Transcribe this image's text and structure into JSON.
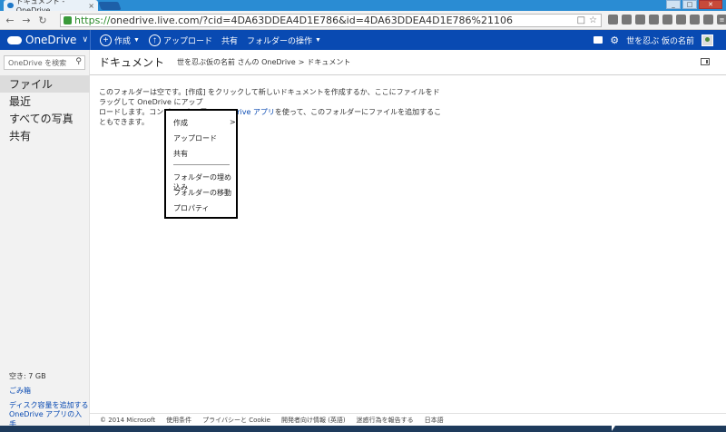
{
  "browser": {
    "tab_title": "ドキュメント - OneDrive",
    "tab_close": "×",
    "url_https": "https://",
    "url_rest": "onedrive.live.com/?cid=4DA63DDEA4D1E786&id=4DA63DDEA4D1E786%21106",
    "window_controls": [
      "_",
      "□",
      "✕"
    ]
  },
  "appbar": {
    "brand": "OneDrive",
    "create": "作成",
    "upload": "アップロード",
    "share": "共有",
    "folder_ops": "フォルダーの操作",
    "user_name": "世を忍ぶ 仮の名前"
  },
  "sidebar": {
    "search_placeholder": "OneDrive を検索",
    "items": [
      "ファイル",
      "最近",
      "すべての写真",
      "共有"
    ],
    "storage": "空き: 7 GB",
    "recycle": "ごみ箱",
    "add_storage": "ディスク容量を追加する",
    "get_apps": "OneDrive アプリの入手"
  },
  "header": {
    "title": "ドキュメント",
    "breadcrumb_owner": "世を忍ぶ仮の名前 さんの OneDrive",
    "breadcrumb_sep": ">",
    "breadcrumb_current": "ドキュメント"
  },
  "empty": {
    "line1": "このフォルダーは空です。[作成] をクリックして新しいドキュメントを作成するか、ここにファイルをドラッグして OneDrive にアップ",
    "line2a": "ロードします。コンピューター用の ",
    "line2_link": "OneDrive アプリ",
    "line2b": "を使って、このフォルダーにファイルを追加することもできます。"
  },
  "context_menu": {
    "create": "作成",
    "arrow": ">",
    "upload": "アップロード",
    "share": "共有",
    "embed": "フォルダーの埋め込み",
    "move": "フォルダーの移動",
    "properties": "プロパティ"
  },
  "footer": {
    "copyright": "© 2014 Microsoft",
    "terms": "使用条件",
    "privacy": "プライバシーと Cookie",
    "developers": "開発者向け情報 (英語)",
    "report": "迷惑行為を報告する",
    "language": "日本語"
  }
}
